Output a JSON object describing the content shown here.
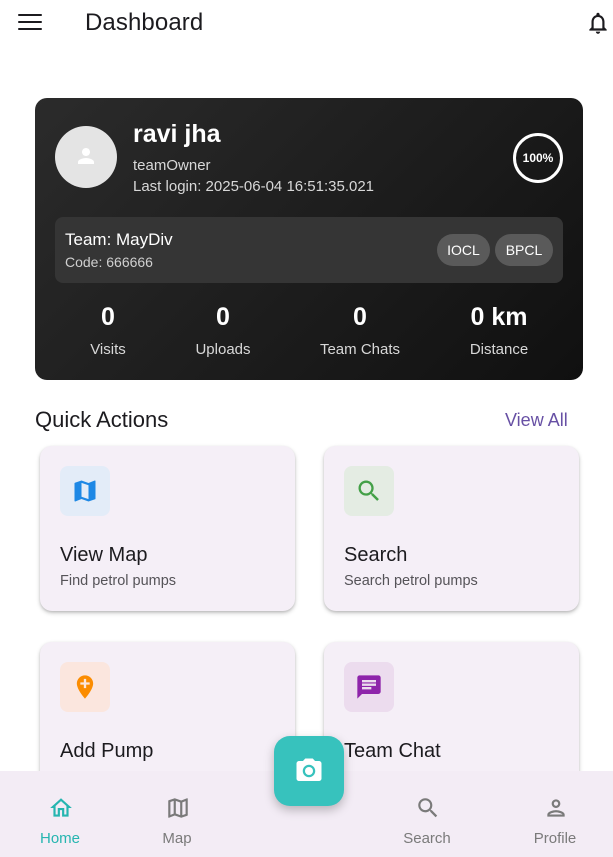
{
  "app_bar": {
    "title": "Dashboard"
  },
  "profile": {
    "name": "ravi jha",
    "role": "teamOwner",
    "last_login": "Last login: 2025-06-04 16:51:35.021",
    "completion": "100%",
    "completion_fraction": 1.0
  },
  "team": {
    "name": "Team: MayDiv",
    "code": "Code: 666666",
    "chips": [
      "IOCL",
      "BPCL"
    ]
  },
  "stats": [
    {
      "value": "0",
      "label": "Visits"
    },
    {
      "value": "0",
      "label": "Uploads"
    },
    {
      "value": "0",
      "label": "Team Chats"
    },
    {
      "value": "0 km",
      "label": "Distance"
    }
  ],
  "quick_actions": {
    "title": "Quick Actions",
    "view_all": "View All",
    "cards": [
      {
        "title": "View Map",
        "subtitle": "Find petrol pumps",
        "icon": "map-icon",
        "color": "#1e88e5",
        "bg": "#e3ecf8"
      },
      {
        "title": "Search",
        "subtitle": "Search petrol pumps",
        "icon": "search-icon",
        "color": "#43a047",
        "bg": "#e4ece3"
      },
      {
        "title": "Add Pump",
        "subtitle": "",
        "icon": "add-location-icon",
        "color": "#fb8c00",
        "bg": "#fbe6de"
      },
      {
        "title": "Team Chat",
        "subtitle": "",
        "icon": "chat-icon",
        "color": "#8e24aa",
        "bg": "#ecdcee"
      }
    ]
  },
  "bottom_nav": {
    "items": [
      {
        "label": "Home",
        "icon": "home-icon",
        "active": true
      },
      {
        "label": "Map",
        "icon": "map-icon",
        "active": false
      },
      {
        "label": "Search",
        "icon": "search-icon",
        "active": false
      },
      {
        "label": "Profile",
        "icon": "person-icon",
        "active": false
      }
    ],
    "fab_icon": "camera-icon"
  },
  "colors": {
    "accent": "#37c2bd",
    "active_nav": "#26b5b0",
    "link": "#6750a4",
    "card_bg": "#f5eff7"
  }
}
